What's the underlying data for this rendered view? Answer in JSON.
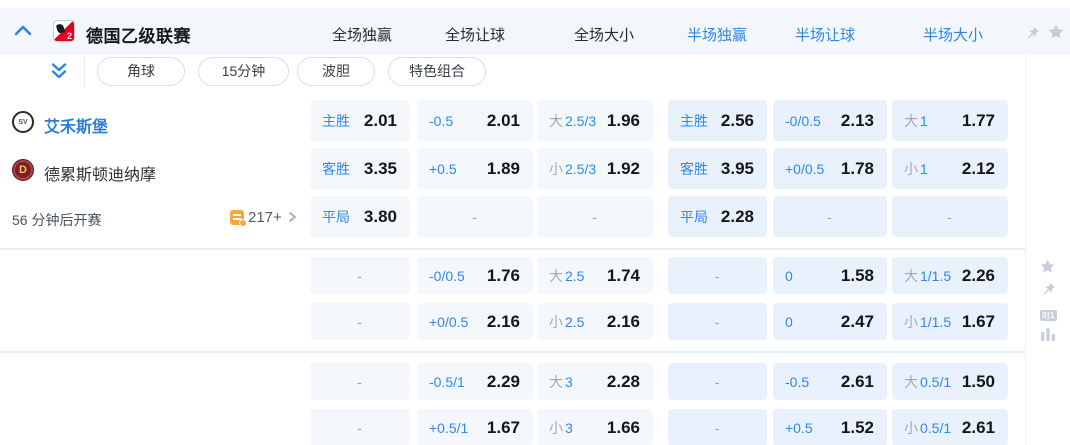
{
  "colors": {
    "accent_blue": "#2e86e0",
    "odds_value_color": "#14161a",
    "full_column_cell_bg": "#f4f8fd",
    "half_column_cell_bg": "#e9f2fc",
    "muted_icon_gray": "#c9cfda",
    "orange_icon": "#f7a63b",
    "league_logo_red": "#e2001a"
  },
  "header": {
    "league_title": "德国乙级联赛",
    "market_tabs": [
      {
        "label": "全场独赢",
        "highlighted": false
      },
      {
        "label": "全场让球",
        "highlighted": false
      },
      {
        "label": "全场大小",
        "highlighted": false
      },
      {
        "label": "半场独赢",
        "highlighted": true
      },
      {
        "label": "半场让球",
        "highlighted": true
      },
      {
        "label": "半场大小",
        "highlighted": true
      }
    ],
    "icons": [
      "collapse-chevron-up-icon",
      "league-logo",
      "pin-icon",
      "star-icon"
    ]
  },
  "filter_pills": [
    "角球",
    "15分钟",
    "波胆",
    "特色组合"
  ],
  "match": {
    "home_team": "艾禾斯堡",
    "home_logo_monogram": "SV",
    "away_team": "德累斯顿迪纳摩",
    "away_logo_monogram": "D",
    "kickoff_text": "56 分钟后开赛",
    "more_markets_count": "217+"
  },
  "odds_grid": {
    "empty_placeholder": "-",
    "rows": [
      [
        {
          "label": "主胜",
          "value": "2.01"
        },
        {
          "label": "-0.5",
          "value": "2.01"
        },
        {
          "prefix": "大",
          "label": "2.5/3",
          "value": "1.96"
        },
        {
          "label": "主胜",
          "value": "2.56"
        },
        {
          "label": "-0/0.5",
          "value": "2.13"
        },
        {
          "prefix": "大",
          "label": "1",
          "value": "1.77"
        }
      ],
      [
        {
          "label": "客胜",
          "value": "3.35"
        },
        {
          "label": "+0.5",
          "value": "1.89"
        },
        {
          "prefix": "小",
          "label": "2.5/3",
          "value": "1.92"
        },
        {
          "label": "客胜",
          "value": "3.95"
        },
        {
          "label": "+0/0.5",
          "value": "1.78"
        },
        {
          "prefix": "小",
          "label": "1",
          "value": "2.12"
        }
      ],
      [
        {
          "label": "平局",
          "value": "3.80"
        },
        null,
        null,
        {
          "label": "平局",
          "value": "2.28"
        },
        null,
        null
      ],
      [
        null,
        {
          "label": "-0/0.5",
          "value": "1.76"
        },
        {
          "prefix": "大",
          "label": "2.5",
          "value": "1.74"
        },
        null,
        {
          "label": "0",
          "value": "1.58"
        },
        {
          "prefix": "大",
          "label": "1/1.5",
          "value": "2.26"
        }
      ],
      [
        null,
        {
          "label": "+0/0.5",
          "value": "2.16"
        },
        {
          "prefix": "小",
          "label": "2.5",
          "value": "2.16"
        },
        null,
        {
          "label": "0",
          "value": "2.47"
        },
        {
          "prefix": "小",
          "label": "1/1.5",
          "value": "1.67"
        }
      ],
      [
        null,
        {
          "label": "-0.5/1",
          "value": "2.29"
        },
        {
          "prefix": "大",
          "label": "3",
          "value": "2.28"
        },
        null,
        {
          "label": "-0.5",
          "value": "2.61"
        },
        {
          "prefix": "大",
          "label": "0.5/1",
          "value": "1.50"
        }
      ],
      [
        null,
        {
          "label": "+0.5/1",
          "value": "1.67"
        },
        {
          "prefix": "小",
          "label": "3",
          "value": "1.66"
        },
        null,
        {
          "label": "+0.5",
          "value": "1.52"
        },
        {
          "prefix": "小",
          "label": "0.5/1",
          "value": "2.61"
        }
      ]
    ]
  },
  "sidebar_icons": [
    "favorite-star-icon",
    "pin-top-icon",
    "odds-format-01-icon",
    "stats-chart-icon"
  ],
  "sidebar_badge_text": "0|1"
}
